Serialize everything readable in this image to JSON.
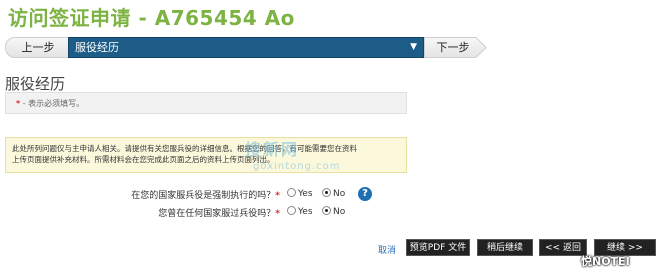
{
  "page": {
    "title": "访问签证申请 - A765454 Ao"
  },
  "wizard": {
    "prev_label": "上一步",
    "current_step": "服役经历",
    "next_label": "下一步"
  },
  "section": {
    "title": "服役经历"
  },
  "required_note": {
    "star": "*",
    "text": " - 表示必须填写。"
  },
  "info": {
    "line1": "此处所列问题仅与主申请人相关。请提供有关您服兵役的详细信息。根据您的回答，有可能需要您在资料",
    "line2": "上传页面提供补充材料。所需材料会在您完成此页面之后的资料上传页面列出。"
  },
  "watermark": {
    "cn": "搜新网",
    "en": "goxintong.com"
  },
  "questions": [
    {
      "label": "在您的国家服兵役是强制执行的吗？",
      "star": "*",
      "yes": "Yes",
      "no": "No",
      "selected": "No"
    },
    {
      "label": "您曾在任何国家服过兵役吗？",
      "star": "*",
      "yes": "Yes",
      "no": "No",
      "selected": "No"
    }
  ],
  "help_icon": "?",
  "actions": {
    "cancel": "取消",
    "preview_pdf": "预览PDF 文件",
    "save_later": "稍后继续",
    "back": "<< 返回",
    "continue": "继续 >>"
  },
  "corner_mark": "悦NOTEI"
}
